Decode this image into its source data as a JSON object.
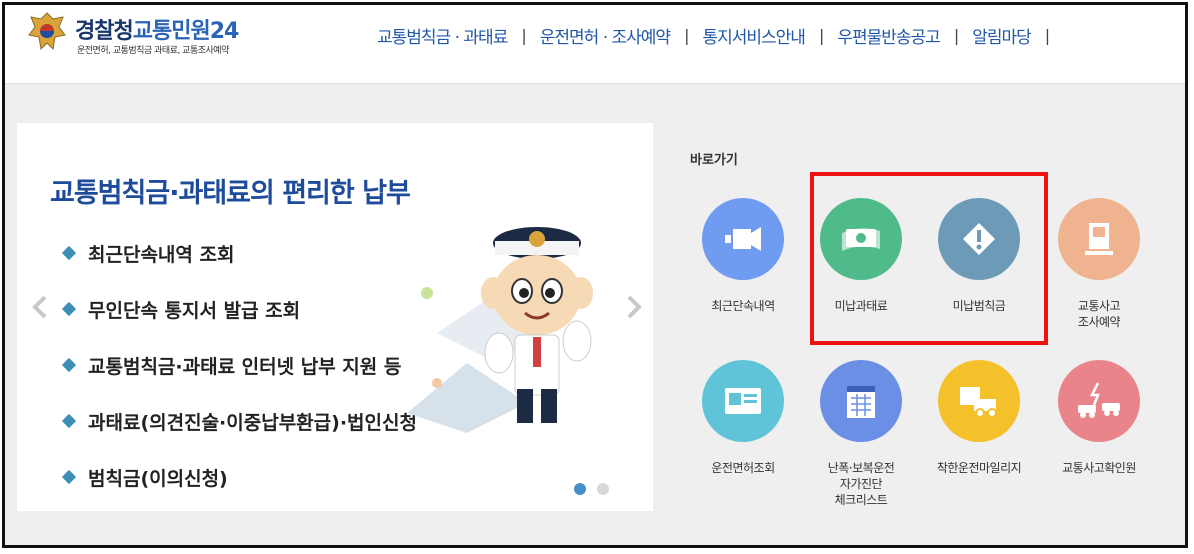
{
  "header": {
    "title_part1": "경찰청",
    "title_part2": "교통민원24",
    "subtitle": "운전면허, 교통범칙금 과태료, 교통조사예약"
  },
  "nav": {
    "items": [
      "교통범칙금 · 과태료",
      "운전면허 · 조사예약",
      "통지서비스안내",
      "우편물반송공고",
      "알림마당"
    ],
    "separator": "|"
  },
  "banner": {
    "heading": "교통범칙금·과태료의 편리한 납부",
    "bullets": [
      "최근단속내역 조회",
      "무인단속 통지서 발급 조회",
      "교통범칙금·과태료 인터넷 납부 지원 등",
      "과태료(의견진술·이중납부환급)·법인신청",
      "범칙금(이의신청)"
    ]
  },
  "shortcuts": {
    "title": "바로가기",
    "items": [
      {
        "label": "최근단속내역",
        "icon": "camera-icon",
        "color": "#6f9bf0"
      },
      {
        "label": "미납과태료",
        "icon": "money-icon",
        "color": "#4fbb8a"
      },
      {
        "label": "미납범칙금",
        "icon": "warning-icon",
        "color": "#6d9bb7"
      },
      {
        "label": "교통사고 조사예약",
        "label_lines": [
          "교통사고",
          "조사예약"
        ],
        "icon": "kiosk-icon",
        "color": "#efb48f"
      },
      {
        "label": "운전면허조회",
        "icon": "license-card-icon",
        "color": "#60c4d8"
      },
      {
        "label": "난폭·보복운전 자가진단 체크리스트",
        "label_lines": [
          "난폭·보복운전",
          "자가진단",
          "체크리스트"
        ],
        "icon": "calendar-checklist-icon",
        "color": "#6c8fe6"
      },
      {
        "label": "착한운전마일리지",
        "icon": "mileage-truck-icon",
        "color": "#f4c12a"
      },
      {
        "label": "교통사고확인원",
        "icon": "car-crash-icon",
        "color": "#e9858a"
      }
    ]
  },
  "colors": {
    "highlight": "#e11111",
    "accent": "#2157a8"
  }
}
